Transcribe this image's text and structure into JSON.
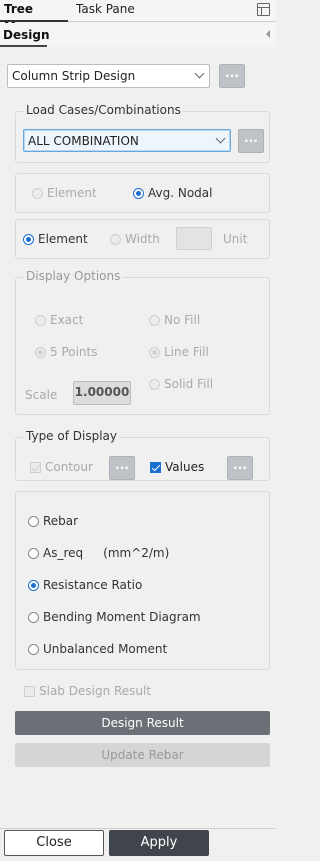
{
  "tabs": {
    "tree_menu": "Tree Menu",
    "task_pane": "Task Pane"
  },
  "design_tab": "Design",
  "design_select": {
    "value": "Column Strip Design",
    "ellipsis": "..."
  },
  "load_cases": {
    "title": "Load Cases/Combinations",
    "value": "ALL COMBINATION",
    "ellipsis": "..."
  },
  "result_location": {
    "element": "Element",
    "avg_nodal": "Avg. Nodal"
  },
  "width_row": {
    "element": "Element",
    "width": "Width",
    "unit": "Unit"
  },
  "display_options": {
    "title": "Display Options",
    "exact": "Exact",
    "five_points": "5 Points",
    "no_fill": "No Fill",
    "line_fill": "Line Fill",
    "solid_fill": "Solid Fill",
    "scale_label": "Scale",
    "scale_value": "1.00000"
  },
  "type_of_display": {
    "title": "Type of Display",
    "contour": "Contour",
    "values": "Values",
    "ellipsis": "..."
  },
  "result_types": {
    "rebar": "Rebar",
    "as_req": "As_req",
    "as_req_unit": "(mm^2/m)",
    "resistance_ratio": "Resistance Ratio",
    "bending_moment": "Bending Moment Diagram",
    "unbalanced_moment": "Unbalanced Moment"
  },
  "slab_design_result": "Slab Design Result",
  "buttons": {
    "design_result": "Design Result",
    "update_rebar": "Update Rebar",
    "close": "Close",
    "apply": "Apply"
  },
  "colors": {
    "accent": "#1a6fd0",
    "dark_button": "#6b7076",
    "apply_button": "#40454b"
  }
}
